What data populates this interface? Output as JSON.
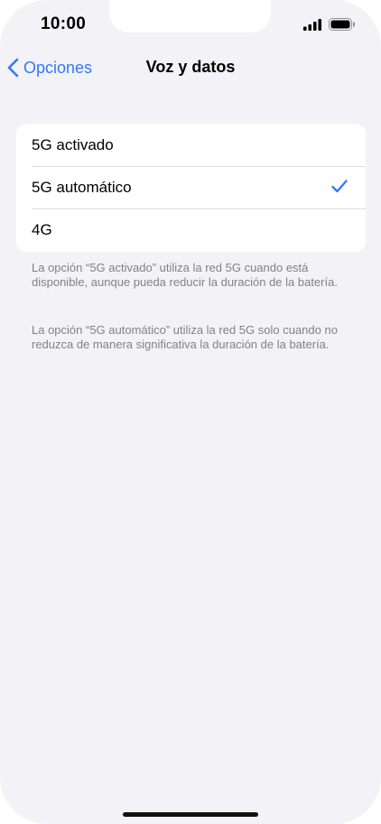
{
  "status_bar": {
    "time": "10:00",
    "icons": [
      "signal-icon",
      "battery-icon"
    ]
  },
  "nav": {
    "back_label": "Opciones",
    "title": "Voz y datos"
  },
  "options": [
    {
      "label": "5G activado",
      "selected": false
    },
    {
      "label": "5G automático",
      "selected": true
    },
    {
      "label": "4G",
      "selected": false
    }
  ],
  "footer": [
    "La opción “5G activado” utiliza la red 5G cuando está disponible, aunque pueda reducir la duración de la batería.",
    "La opción “5G automático” utiliza la red 5G solo cuando no reduzca de manera significativa la duración de la batería."
  ],
  "colors": {
    "accent": "#3478f6",
    "background": "#f2f2f7",
    "footer_text": "#818189"
  }
}
